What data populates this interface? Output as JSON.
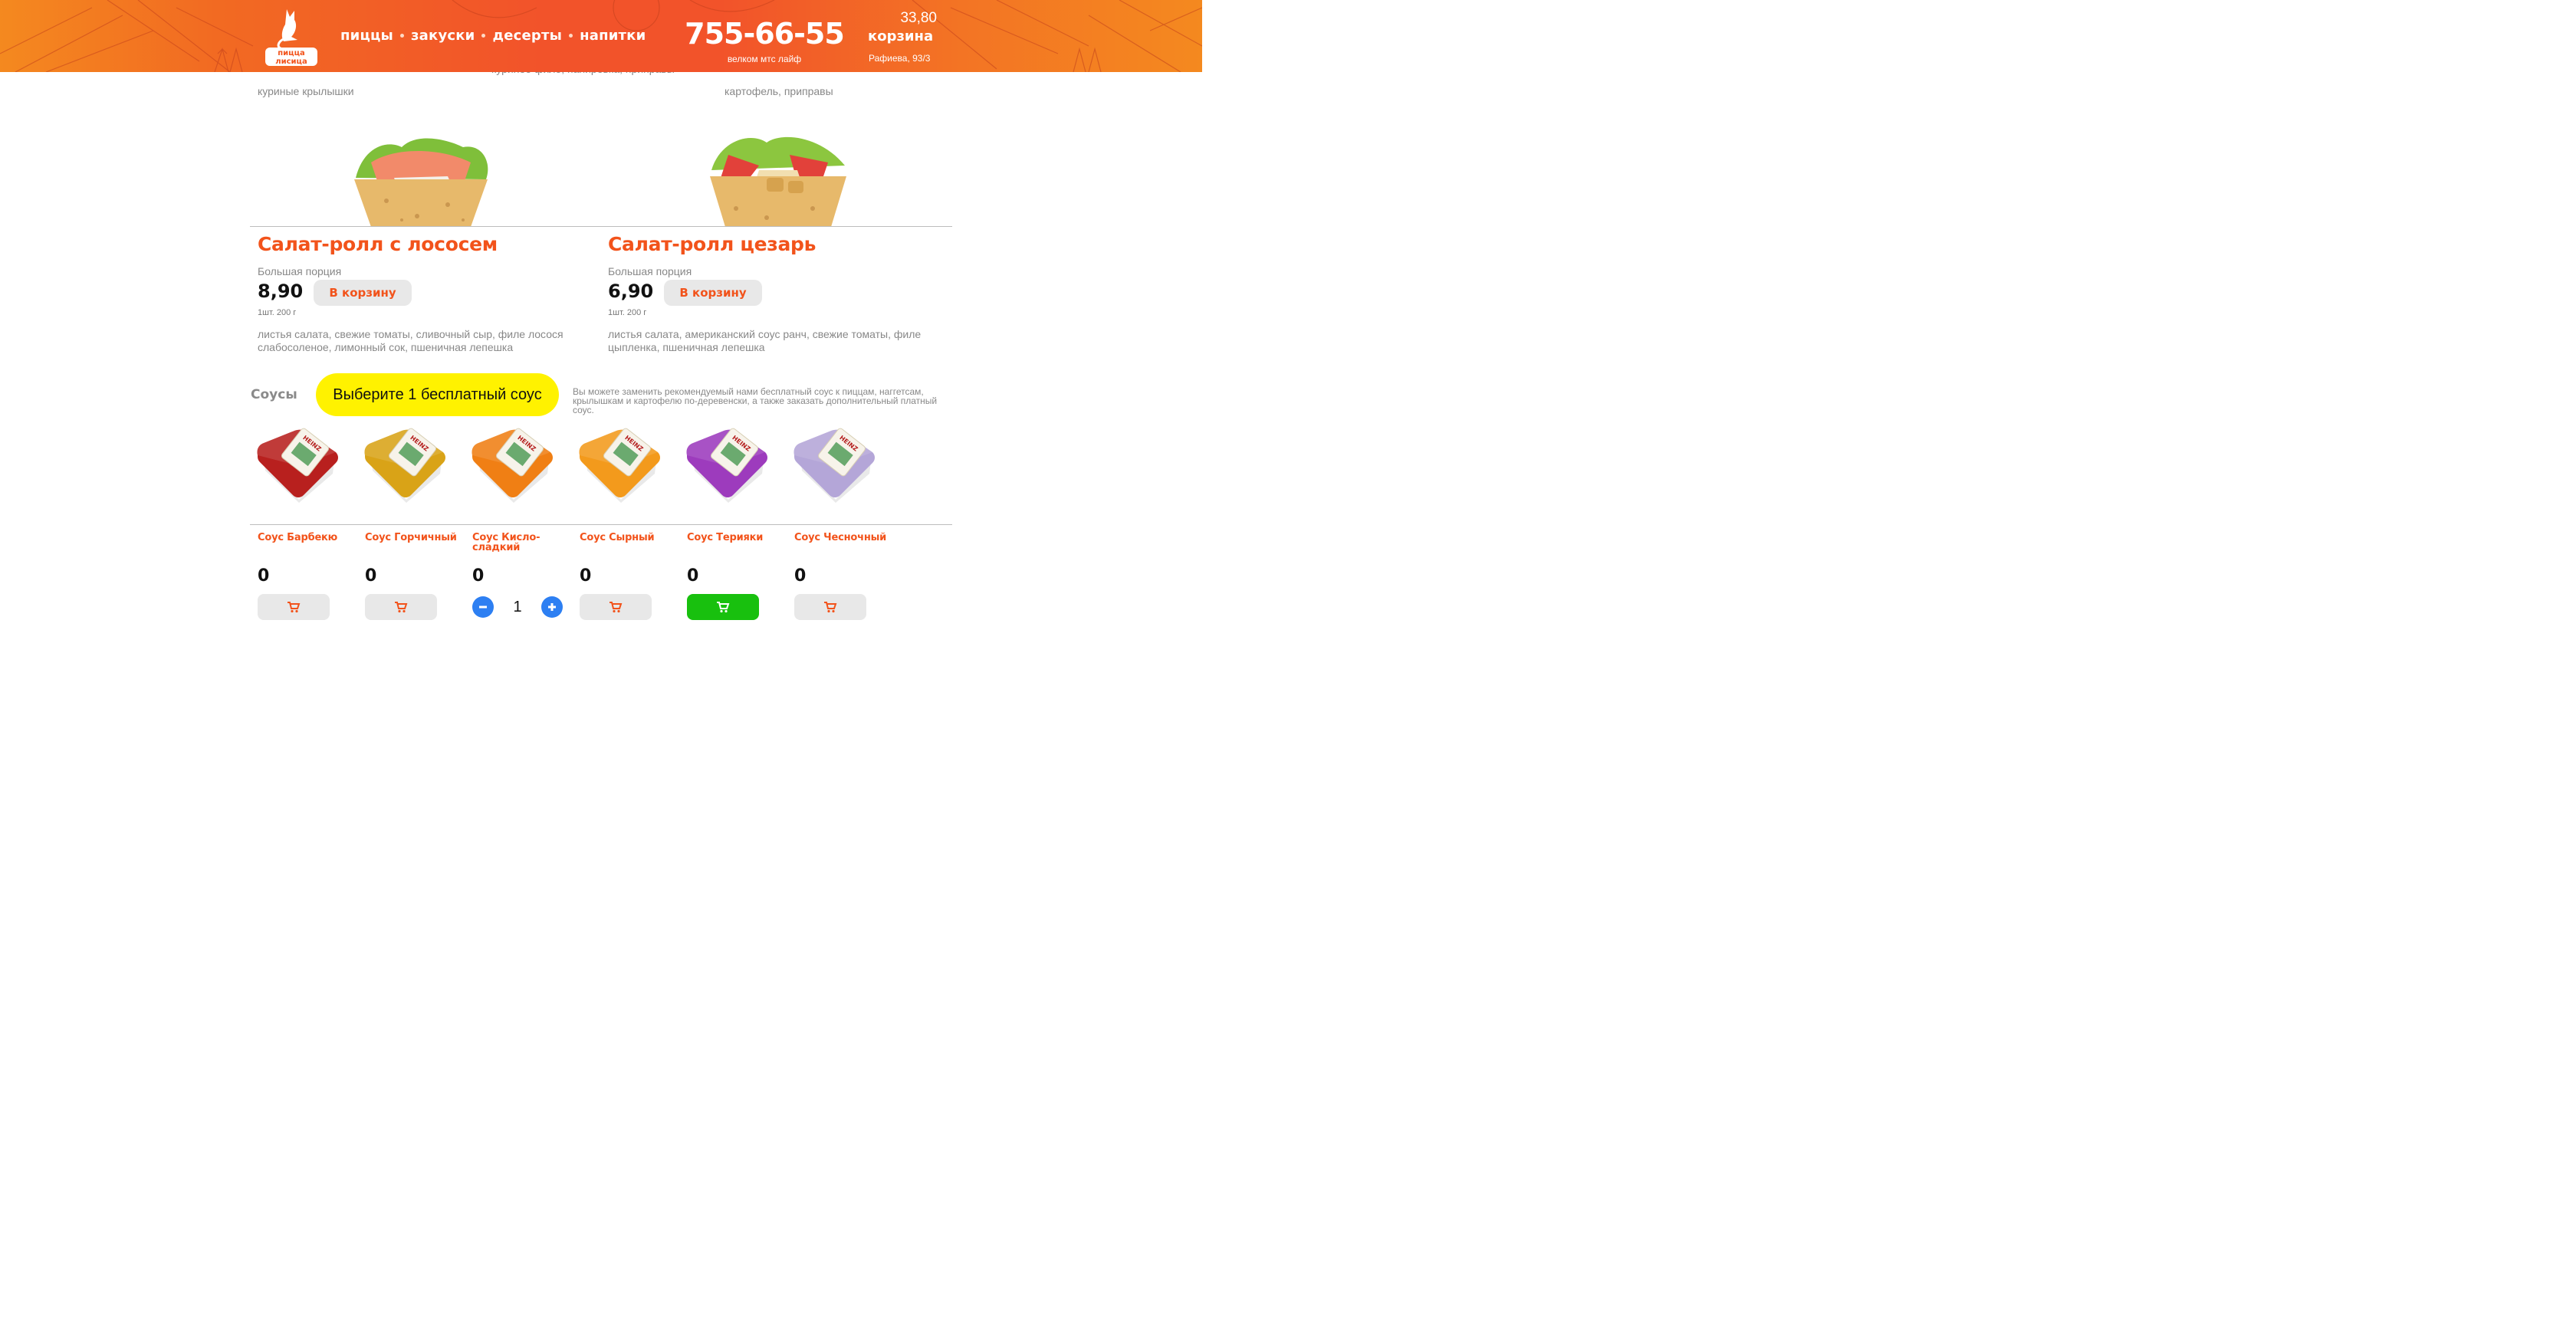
{
  "header": {
    "logo_text": "пицца лисица",
    "nav": [
      "пиццы",
      "закуски",
      "десерты",
      "напитки"
    ],
    "phone": "755-66-55",
    "phone_sub": "велком мтс лайф",
    "cart_sum": "33,80",
    "cart_label": "корзина",
    "address": "Рафиева, 93/3"
  },
  "top_row": {
    "left_line": "куриные крылышки",
    "middle_line": "куриное филе, панировка, приправы",
    "right_line": "картофель, приправы"
  },
  "products": [
    {
      "title": "Салат-ролл с лососем",
      "portion": "Большая порция",
      "price": "8,90",
      "button": "В корзину",
      "weight": "1шт. 200 г",
      "ingredients": "листья салата, свежие томаты, сливочный сыр, филе лосося слабосоленое, лимонный сок, пшеничная лепешка"
    },
    {
      "title": "Салат-ролл цезарь",
      "portion": "Большая порция",
      "price": "6,90",
      "button": "В корзину",
      "weight": "1шт. 200 г",
      "ingredients": "листья салата, американский соус ранч, свежие томаты, филе цыпленка, пшеничная лепешка"
    }
  ],
  "sauces_section": {
    "title": "Соусы",
    "free_button": "Выберите 1 бесплатный соус",
    "note": "Вы можете заменить рекомендуемый нами бесплатный соус к пиццам, наггетсам, крылышкам и картофелю по-деревенски, а также заказать дополнительный платный соус."
  },
  "sauces": [
    {
      "name": "Соус Барбекю",
      "count": "0",
      "color": "#b8201e",
      "brand": "HEINZ"
    },
    {
      "name": "Соус Горчичный",
      "count": "0",
      "color": "#d9a317",
      "brand": "HEINZ"
    },
    {
      "name": "Соус Кисло-сладкий",
      "count": "0",
      "color": "#f07f14",
      "brand": "HEINZ",
      "quantity": "1"
    },
    {
      "name": "Соус Сырный",
      "count": "0",
      "color": "#f39a1c",
      "brand": "HEINZ"
    },
    {
      "name": "Соус Терияки",
      "count": "0",
      "color": "#9d3bbd",
      "brand": "HEINZ"
    },
    {
      "name": "Соус Чесночный",
      "count": "0",
      "color": "#b4a6d8",
      "brand": "HEINZ"
    }
  ],
  "colors": {
    "accent": "#f2531b",
    "header": "#f2532a",
    "highlight": "#fff200",
    "active_cart": "#18c00e",
    "stepper": "#2d7ff2"
  },
  "icons": [
    "logo-fox",
    "cart-icon",
    "minus-icon",
    "plus-icon"
  ]
}
